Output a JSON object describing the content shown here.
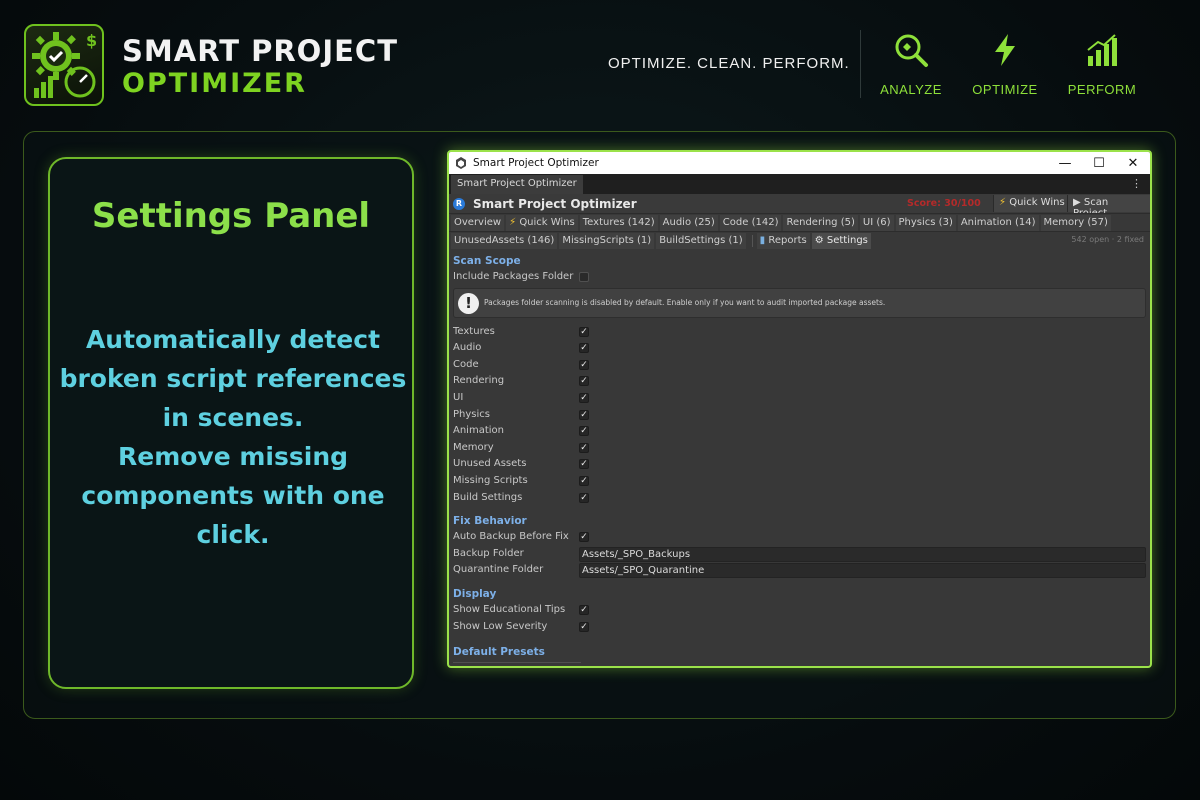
{
  "brand": {
    "title": "SMART PROJECT",
    "subtitle": "OPTIMIZER",
    "tagline": "OPTIMIZE. CLEAN. PERFORM.",
    "accent_color": "#7ed321"
  },
  "header_items": [
    {
      "label": "ANALYZE",
      "icon": "magnifier-icon"
    },
    {
      "label": "OPTIMIZE",
      "icon": "lightning-icon"
    },
    {
      "label": "PERFORM",
      "icon": "bar-chart-icon"
    }
  ],
  "card": {
    "title": "Settings Panel",
    "lines": [
      "Automatically detect",
      "broken script references",
      "in scenes.",
      "Remove missing",
      "components with one",
      "click."
    ]
  },
  "window": {
    "title": "Smart Project Optimizer",
    "controls": {
      "minimize": "—",
      "maximize": "☐",
      "close": "✕"
    },
    "tab_label": "Smart Project Optimizer",
    "menu_icon": "⋮",
    "app_name": "Smart Project Optimizer",
    "app_icon_letter": "R",
    "score": "Score: 30/100",
    "quick_wins": "Quick Wins",
    "scan_project": "Scan Project",
    "tabs_row1": [
      "Overview",
      "Quick Wins",
      "Textures (142)",
      "Audio (25)",
      "Code (142)",
      "Rendering (5)",
      "UI (6)",
      "Physics (3)",
      "Animation (14)",
      "Memory (57)"
    ],
    "tabs_row2": [
      "UnusedAssets (146)",
      "MissingScripts (1)",
      "BuildSettings (1)"
    ],
    "reports": "Reports",
    "settings": "Settings",
    "status": "542 open · 2 fixed",
    "scan_scope": {
      "heading": "Scan Scope",
      "include_packages": "Include Packages Folder",
      "help": "Packages folder scanning is disabled by default. Enable only if you want to audit imported package assets.",
      "categories": [
        "Textures",
        "Audio",
        "Code",
        "Rendering",
        "UI",
        "Physics",
        "Animation",
        "Memory",
        "Unused Assets",
        "Missing Scripts",
        "Build Settings"
      ]
    },
    "fix_behavior": {
      "heading": "Fix Behavior",
      "auto_backup": "Auto Backup Before Fix",
      "backup_folder_label": "Backup Folder",
      "backup_folder_value": "Assets/_SPO_Backups",
      "quarantine_label": "Quarantine Folder",
      "quarantine_value": "Assets/_SPO_Quarantine"
    },
    "display": {
      "heading": "Display",
      "tips": "Show Educational Tips",
      "low_severity": "Show Low Severity"
    },
    "presets_heading": "Default Presets"
  }
}
